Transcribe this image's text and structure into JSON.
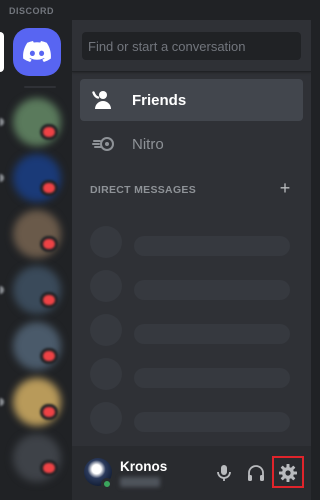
{
  "app": {
    "title": "DISCORD"
  },
  "search": {
    "placeholder": "Find or start a conversation"
  },
  "nav": [
    {
      "label": "Friends",
      "icon": "friends-icon",
      "active": true
    },
    {
      "label": "Nitro",
      "icon": "nitro-icon",
      "active": false
    }
  ],
  "direct_messages": {
    "header": "DIRECT MESSAGES",
    "add_icon": "plus-icon"
  },
  "user": {
    "name": "Kronos",
    "status": "online"
  },
  "controls": [
    "microphone-icon",
    "headphones-icon",
    "gear-icon"
  ],
  "colors": {
    "brand": "#5865f2",
    "badge": "#ed4245",
    "online": "#3ba55d",
    "highlight": "#e0242b"
  }
}
